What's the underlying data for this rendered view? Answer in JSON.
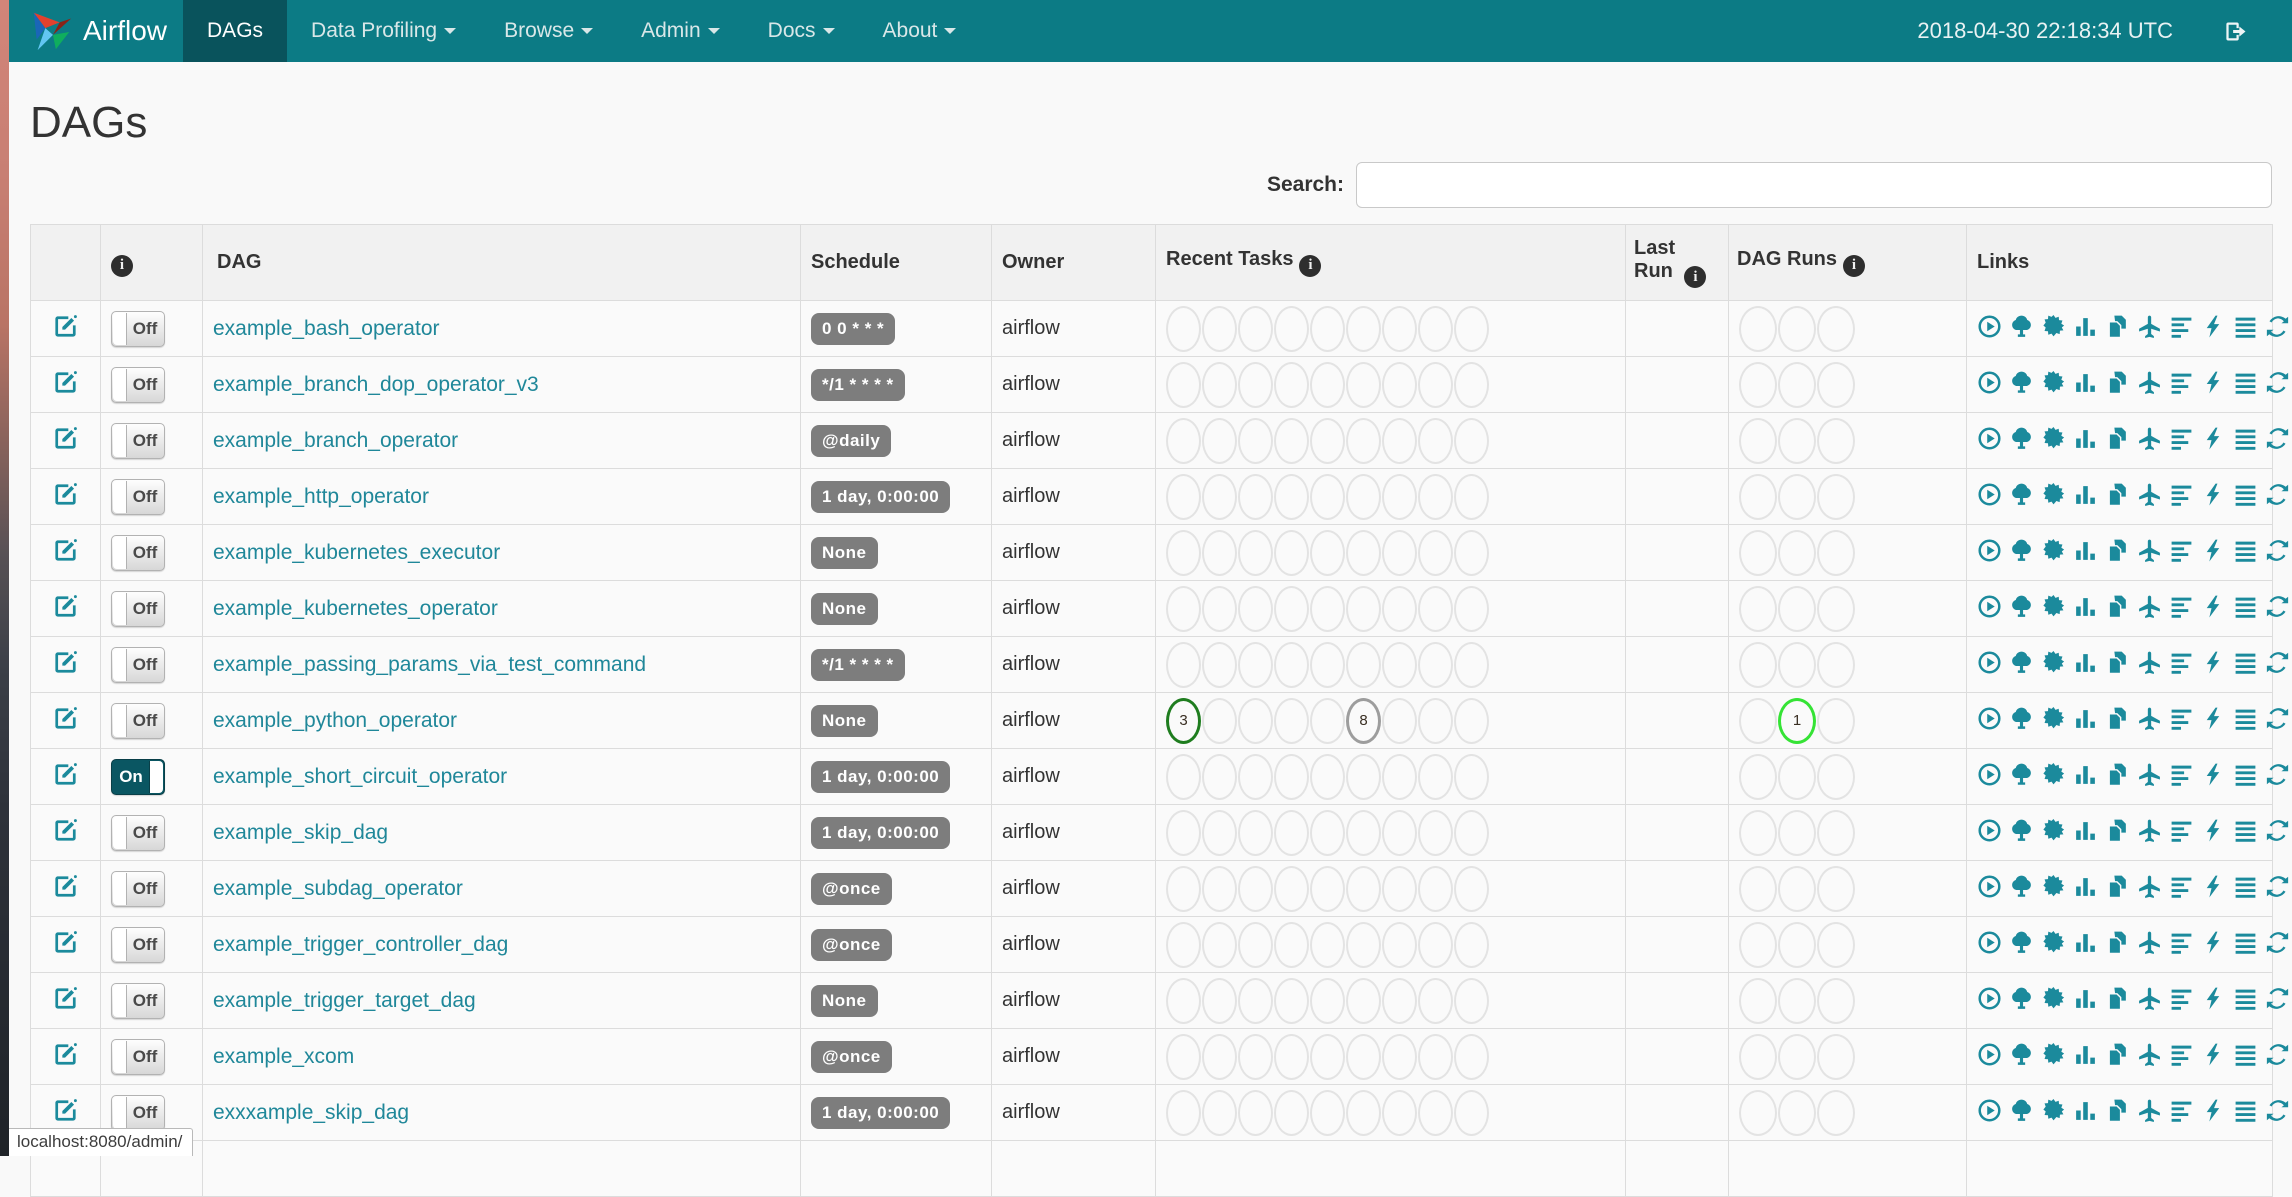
{
  "navbar": {
    "brand": "Airflow",
    "items": [
      {
        "label": "DAGs",
        "active": true,
        "caret": false
      },
      {
        "label": "Data Profiling",
        "active": false,
        "caret": true
      },
      {
        "label": "Browse",
        "active": false,
        "caret": true
      },
      {
        "label": "Admin",
        "active": false,
        "caret": true
      },
      {
        "label": "Docs",
        "active": false,
        "caret": true
      },
      {
        "label": "About",
        "active": false,
        "caret": true
      }
    ],
    "clock": "2018-04-30 22:18:34 UTC"
  },
  "page": {
    "title": "DAGs",
    "search_label": "Search:",
    "search_value": ""
  },
  "table": {
    "headers": {
      "dag": "DAG",
      "schedule": "Schedule",
      "owner": "Owner",
      "recent_tasks": "Recent Tasks",
      "last_run": "Last Run",
      "dag_runs": "DAG Runs",
      "links": "Links"
    },
    "recent_tasks_slots": 9,
    "dag_runs_slots": 3,
    "links_icons": [
      "trigger-dag",
      "tree-view",
      "graph-view",
      "task-duration",
      "task-tries",
      "landing-times",
      "gantt-view",
      "code-view",
      "logs",
      "refresh"
    ],
    "rows": [
      {
        "toggle": "Off",
        "dag": "example_bash_operator",
        "schedule": "0 0 * * *",
        "owner": "airflow",
        "recent_tasks": [],
        "last_run": "",
        "dag_runs": []
      },
      {
        "toggle": "Off",
        "dag": "example_branch_dop_operator_v3",
        "schedule": "*/1 * * * *",
        "owner": "airflow",
        "recent_tasks": [],
        "last_run": "",
        "dag_runs": []
      },
      {
        "toggle": "Off",
        "dag": "example_branch_operator",
        "schedule": "@daily",
        "owner": "airflow",
        "recent_tasks": [],
        "last_run": "",
        "dag_runs": []
      },
      {
        "toggle": "Off",
        "dag": "example_http_operator",
        "schedule": "1 day, 0:00:00",
        "owner": "airflow",
        "recent_tasks": [],
        "last_run": "",
        "dag_runs": []
      },
      {
        "toggle": "Off",
        "dag": "example_kubernetes_executor",
        "schedule": "None",
        "owner": "airflow",
        "recent_tasks": [],
        "last_run": "",
        "dag_runs": []
      },
      {
        "toggle": "Off",
        "dag": "example_kubernetes_operator",
        "schedule": "None",
        "owner": "airflow",
        "recent_tasks": [],
        "last_run": "",
        "dag_runs": []
      },
      {
        "toggle": "Off",
        "dag": "example_passing_params_via_test_command",
        "schedule": "*/1 * * * *",
        "owner": "airflow",
        "recent_tasks": [],
        "last_run": "",
        "dag_runs": []
      },
      {
        "toggle": "Off",
        "dag": "example_python_operator",
        "schedule": "None",
        "owner": "airflow",
        "recent_tasks": [
          {
            "slot": 0,
            "count": "3",
            "state": "success"
          },
          {
            "slot": 5,
            "count": "8",
            "state": "none"
          }
        ],
        "last_run": "",
        "dag_runs": [
          {
            "slot": 1,
            "count": "1",
            "state": "running"
          }
        ]
      },
      {
        "toggle": "On",
        "dag": "example_short_circuit_operator",
        "schedule": "1 day, 0:00:00",
        "owner": "airflow",
        "recent_tasks": [],
        "last_run": "",
        "dag_runs": []
      },
      {
        "toggle": "Off",
        "dag": "example_skip_dag",
        "schedule": "1 day, 0:00:00",
        "owner": "airflow",
        "recent_tasks": [],
        "last_run": "",
        "dag_runs": []
      },
      {
        "toggle": "Off",
        "dag": "example_subdag_operator",
        "schedule": "@once",
        "owner": "airflow",
        "recent_tasks": [],
        "last_run": "",
        "dag_runs": []
      },
      {
        "toggle": "Off",
        "dag": "example_trigger_controller_dag",
        "schedule": "@once",
        "owner": "airflow",
        "recent_tasks": [],
        "last_run": "",
        "dag_runs": []
      },
      {
        "toggle": "Off",
        "dag": "example_trigger_target_dag",
        "schedule": "None",
        "owner": "airflow",
        "recent_tasks": [],
        "last_run": "",
        "dag_runs": []
      },
      {
        "toggle": "Off",
        "dag": "example_xcom",
        "schedule": "@once",
        "owner": "airflow",
        "recent_tasks": [],
        "last_run": "",
        "dag_runs": []
      },
      {
        "toggle": "Off",
        "dag": "exxxample_skip_dag",
        "schedule": "1 day, 0:00:00",
        "owner": "airflow",
        "recent_tasks": [],
        "last_run": "",
        "dag_runs": []
      }
    ]
  },
  "status_bar": {
    "url": "localhost:8080/admin/"
  },
  "colors": {
    "navbar": "#0c7b85",
    "navbar_active": "#09535c",
    "accent_teal": "#1b8a9c",
    "toggle_on": "#0a5662",
    "schedule_badge": "#7d7d7d",
    "states": {
      "success": "#1f7d1f",
      "running": "#35e335",
      "none": "#9d9d9d"
    }
  }
}
